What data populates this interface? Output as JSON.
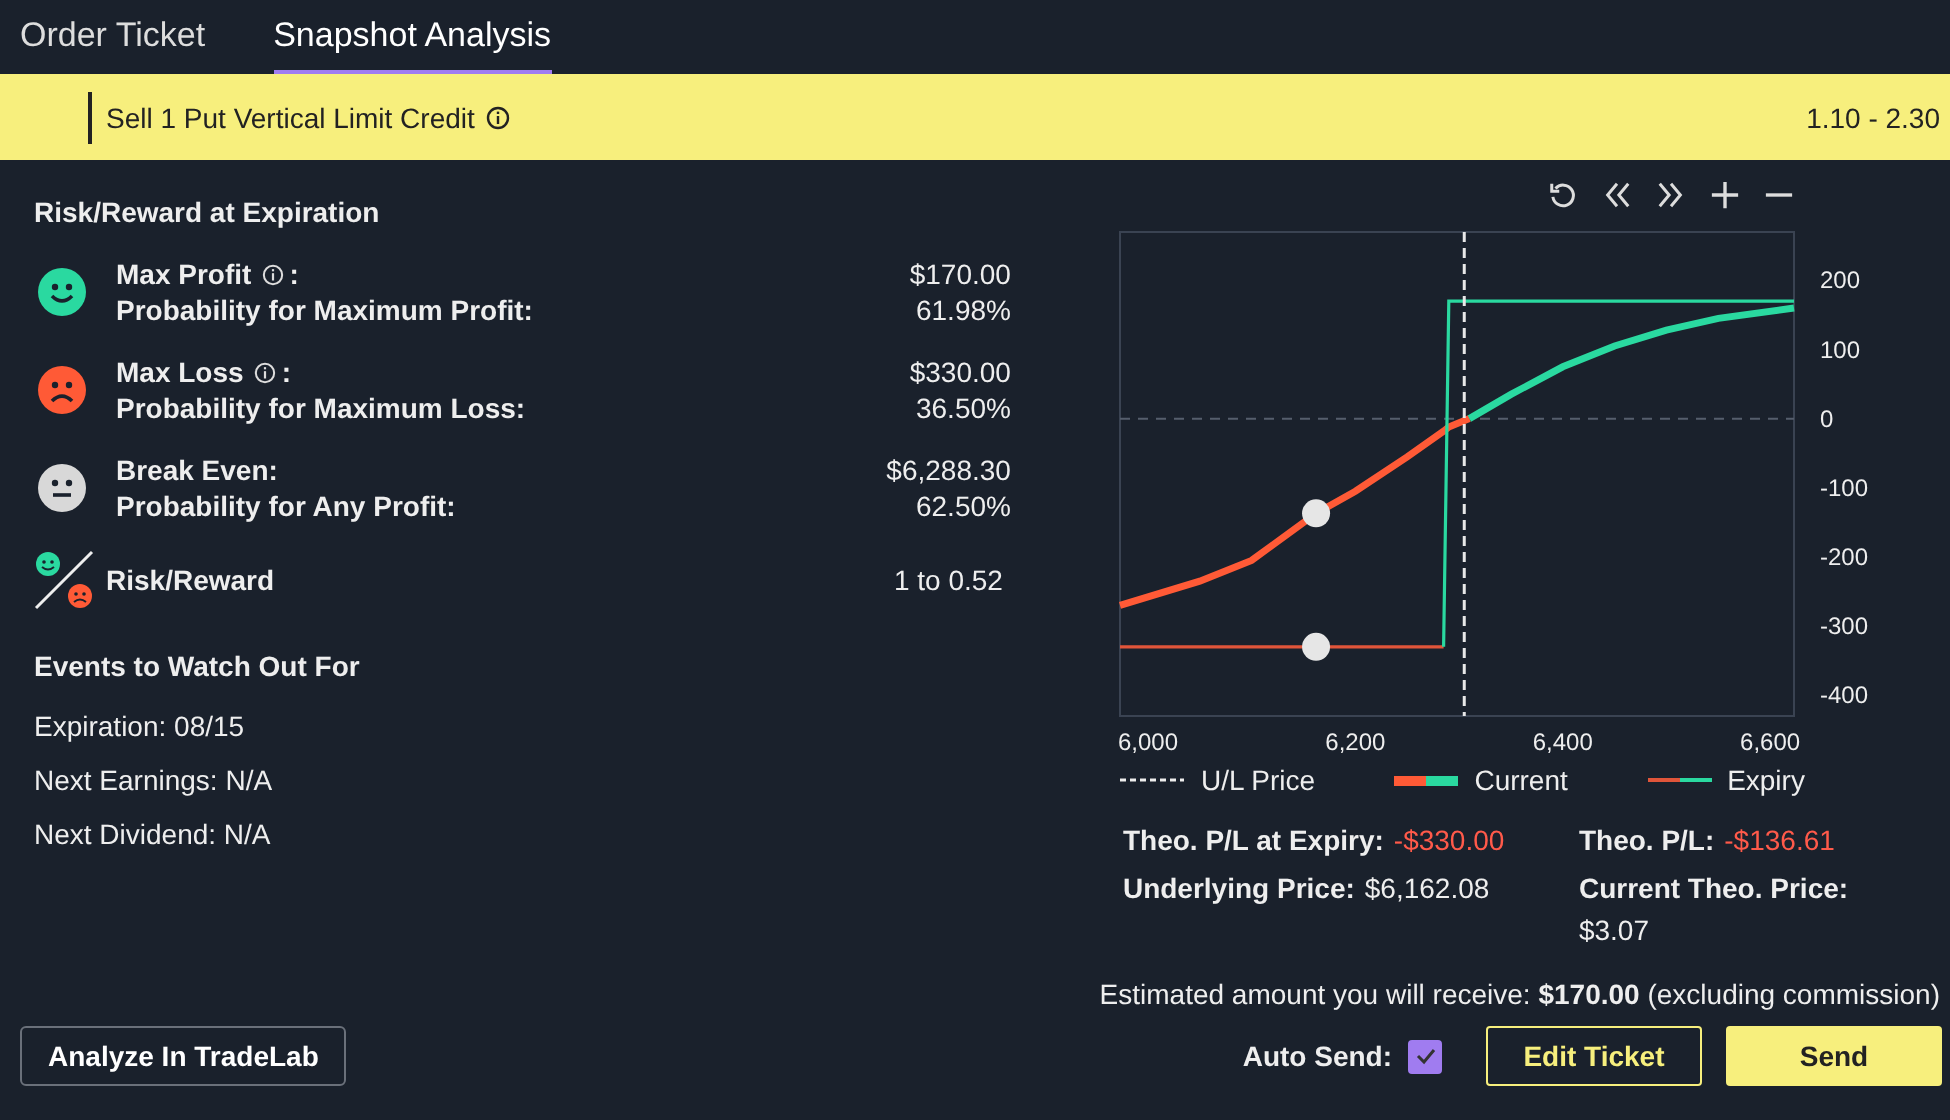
{
  "tabs": [
    {
      "label": "Order Ticket",
      "selected": false
    },
    {
      "label": "Snapshot Analysis",
      "selected": true
    }
  ],
  "order_bar": {
    "description": "Sell 1 Put Vertical Limit Credit",
    "price_range": "1.10 - 2.30"
  },
  "risk_reward": {
    "title": "Risk/Reward at Expiration",
    "metrics": [
      {
        "kind": "profit",
        "label": "Max Profit",
        "info": true,
        "colon": ":",
        "value": "$170.00",
        "prob_label": "Probability for Maximum Profit:",
        "prob_value": "61.98%"
      },
      {
        "kind": "loss",
        "label": "Max Loss",
        "info": true,
        "colon": ":",
        "value": "$330.00",
        "prob_label": "Probability for Maximum Loss:",
        "prob_value": "36.50%"
      },
      {
        "kind": "neutral",
        "label": "Break Even:",
        "info": false,
        "value": "$6,288.30",
        "prob_label": "Probability for Any Profit:",
        "prob_value": "62.50%"
      }
    ],
    "ratio_label": "Risk/Reward",
    "ratio_value": "1 to 0.52"
  },
  "events": {
    "title": "Events to Watch Out For",
    "items": [
      "Expiration: 08/15",
      "Next Earnings: N/A",
      "Next Dividend: N/A"
    ]
  },
  "chart": {
    "chart_data": {
      "type": "line",
      "xlim": [
        5973,
        6623
      ],
      "ylim": [
        -430,
        270
      ],
      "xticks": [
        {
          "value": 6000,
          "label": "6,000"
        },
        {
          "value": 6200,
          "label": "6,200"
        },
        {
          "value": 6400,
          "label": "6,400"
        },
        {
          "value": 6600,
          "label": "6,600"
        }
      ],
      "yticks": [
        200,
        100,
        0,
        -100,
        -200,
        -300,
        -400
      ],
      "x": [
        5973,
        6050,
        6100,
        6162,
        6200,
        6250,
        6285,
        6290,
        6310,
        6350,
        6400,
        6450,
        6500,
        6550,
        6623
      ],
      "series": [
        {
          "name": "Current",
          "color": "#ff5a36",
          "values": [
            -270,
            -235,
            -205,
            -137,
            -105,
            -55,
            -18,
            -12,
            0,
            null,
            null,
            null,
            null,
            null,
            null
          ]
        },
        {
          "color": "#2ad9a0",
          "values": [
            null,
            null,
            null,
            null,
            null,
            null,
            null,
            null,
            0,
            35,
            75,
            105,
            128,
            145,
            160
          ]
        },
        {
          "name": "Expiry",
          "color": "#e0553a",
          "values": [
            -330,
            -330,
            -330,
            -330,
            -330,
            -330,
            -330,
            null,
            null,
            null,
            null,
            null,
            null,
            null,
            null
          ]
        },
        {
          "color": "#2ad9a0",
          "values": [
            null,
            null,
            null,
            null,
            null,
            null,
            -330,
            170,
            170,
            170,
            170,
            170,
            170,
            170,
            170
          ]
        }
      ],
      "ref_lines": [
        {
          "axis": "x",
          "value": 6305,
          "label": "U/L Price"
        }
      ]
    }
  },
  "theo": [
    {
      "label": "Theo. P/L at Expiry:",
      "value": "-$330.00",
      "negative": true
    },
    {
      "label": "Theo. P/L:",
      "value": "-$136.61",
      "negative": true
    },
    {
      "label": "Underlying Price:",
      "value": "$6,162.08",
      "negative": false
    },
    {
      "label": "Current Theo. Price:",
      "value": "$3.07",
      "negative": false
    }
  ],
  "estimate": "Estimated amount you will receive: **$170.00** (excluding commission)",
  "analyze_button": "Analyze In TradeLab",
  "auto_send": {
    "label": "Auto Send:",
    "checked": true
  },
  "buttons": [
    "Edit Ticket",
    "Send"
  ]
}
